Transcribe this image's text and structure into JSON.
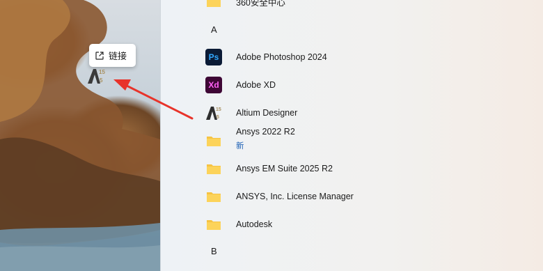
{
  "desktop": {
    "link_tooltip": {
      "label": "链接",
      "icon": "external-link-icon"
    },
    "shortcut_icon": "altium-designer-icon"
  },
  "start_menu": {
    "top_item": {
      "label": "360安全中心",
      "icon": "folder-icon"
    },
    "section_a": "A",
    "items": [
      {
        "label": "Adobe Photoshop 2024",
        "icon": "photoshop-icon",
        "icon_text": "Ps"
      },
      {
        "label": "Adobe XD",
        "icon": "adobe-xd-icon",
        "icon_text": "Xd"
      },
      {
        "label": "Altium Designer",
        "icon": "altium-designer-icon"
      },
      {
        "label": "Ansys 2022 R2",
        "sublabel": "新",
        "icon": "folder-icon"
      },
      {
        "label": "Ansys EM Suite 2025 R2",
        "icon": "folder-icon"
      },
      {
        "label": "ANSYS, Inc. License Manager",
        "icon": "folder-icon"
      },
      {
        "label": "Autodesk",
        "icon": "folder-icon"
      }
    ],
    "section_b": "B"
  },
  "colors": {
    "folder": "#f6c342",
    "arrow": "#e8332a",
    "new_badge": "#1a5fb4"
  }
}
